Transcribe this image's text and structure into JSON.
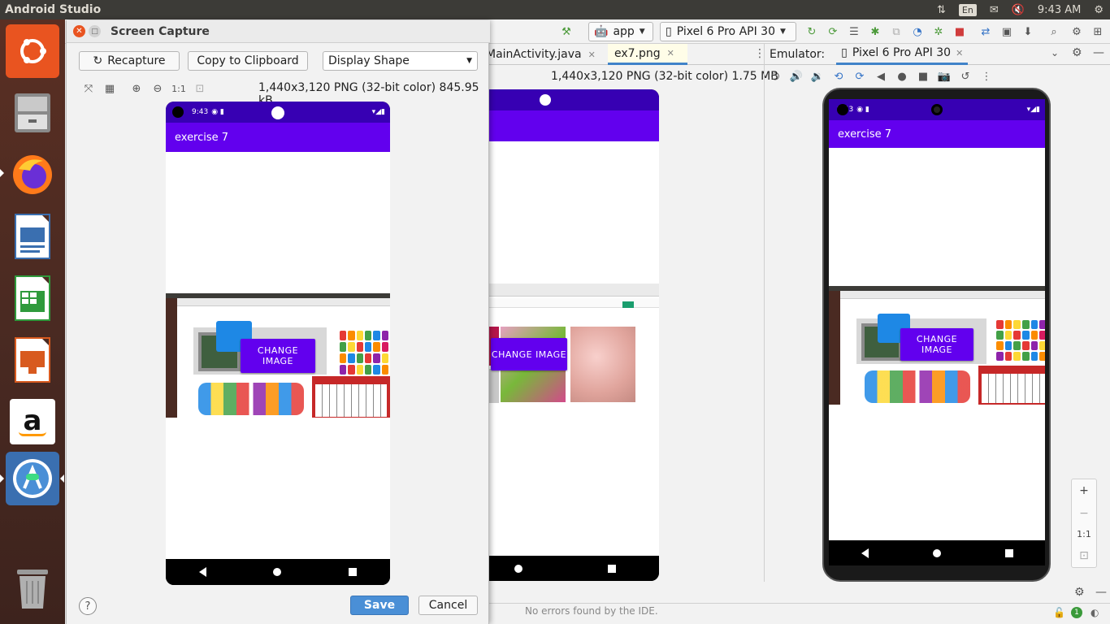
{
  "top_panel": {
    "app_name": "Android Studio",
    "keyboard_lang": "En",
    "clock": "9:43 AM"
  },
  "launcher": {
    "items": [
      "ubuntu-dash",
      "files",
      "firefox",
      "libreoffice-writer",
      "libreoffice-calc",
      "libreoffice-impress",
      "amazon",
      "android-studio",
      "trash"
    ]
  },
  "toolbar": {
    "run_config": "app",
    "device": "Pixel 6 Pro API 30"
  },
  "editor": {
    "tabs": [
      {
        "label": "MainActivity.java",
        "selected": false
      },
      {
        "label": "ex7.png",
        "selected": true
      }
    ],
    "image_info": "1,440x3,120 PNG (32-bit color) 1.75 MB"
  },
  "emulator": {
    "label": "Emulator:",
    "tab": "Pixel 6 Pro API 30",
    "zoom": {
      "in": "+",
      "out": "−",
      "actual": "1:1"
    }
  },
  "status": {
    "text": "No errors found by the IDE."
  },
  "dialog": {
    "title": "Screen Capture",
    "recapture": "Recapture",
    "copy": "Copy to Clipboard",
    "display_shape": "Display Shape",
    "actual_size": "1:1",
    "image_info": "1,440x3,120 PNG (32-bit color) 845.95 kB",
    "help": "?",
    "save": "Save",
    "cancel": "Cancel"
  },
  "phone": {
    "time": "9:43",
    "app_title": "exercise 7",
    "button": "CHANGE IMAGE"
  },
  "colors": {
    "primary": "#6200ee",
    "primary_dark": "#3700b3",
    "save_button": "#4a8fd6",
    "ubuntu_orange": "#e95420"
  }
}
